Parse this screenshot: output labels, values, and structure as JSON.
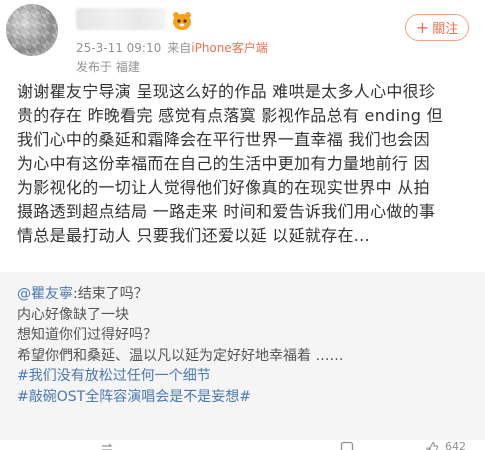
{
  "post": {
    "meta": {
      "time": "25-3-11 09:10",
      "from_prefix": "来自",
      "source": "iPhone客户端",
      "location": "发布于 福建"
    },
    "follow_label": "關注",
    "body_lines": [
      "谢谢瞿友宁导演 呈现这么好的作品 难哄是太多人心中很珍",
      "贵的存在 昨晚看完 感觉有点落寞 影视作品总有 ending 但",
      "我们心中的桑延和霜降会在平行世界一直幸福 我们也会因",
      "为心中有这份幸福而在自己的生活中更加有力量地前行 因",
      "为影视化的一切让人觉得他们好像真的在现实世界中 从拍",
      "摄路透到超点结局 一路走来 时间和爱告诉我们用心做的事",
      "情总是最打动人 只要我们还爱以延 以延就存在..."
    ]
  },
  "repost": {
    "mention": "@瞿友寧",
    "mention_rest": ":结束了吗？",
    "lines": [
      "内心好像缺了一块",
      "想知道你们过得好吗？",
      "希望你們和桑延、温以凡以延为定好好地幸福着 ……"
    ],
    "tags": [
      "#我们没有放松过任何一个细节",
      "#敲碗OST全阵容演唱会是不是妄想#"
    ]
  },
  "actions": {
    "like_count": "642"
  },
  "colors": {
    "accent": "#eb7350",
    "link": "#4a79b3",
    "repost_bg": "#f5f5f5"
  },
  "icons": [
    "member-icon",
    "plus-icon",
    "repost-icon",
    "comment-icon",
    "like-icon"
  ]
}
